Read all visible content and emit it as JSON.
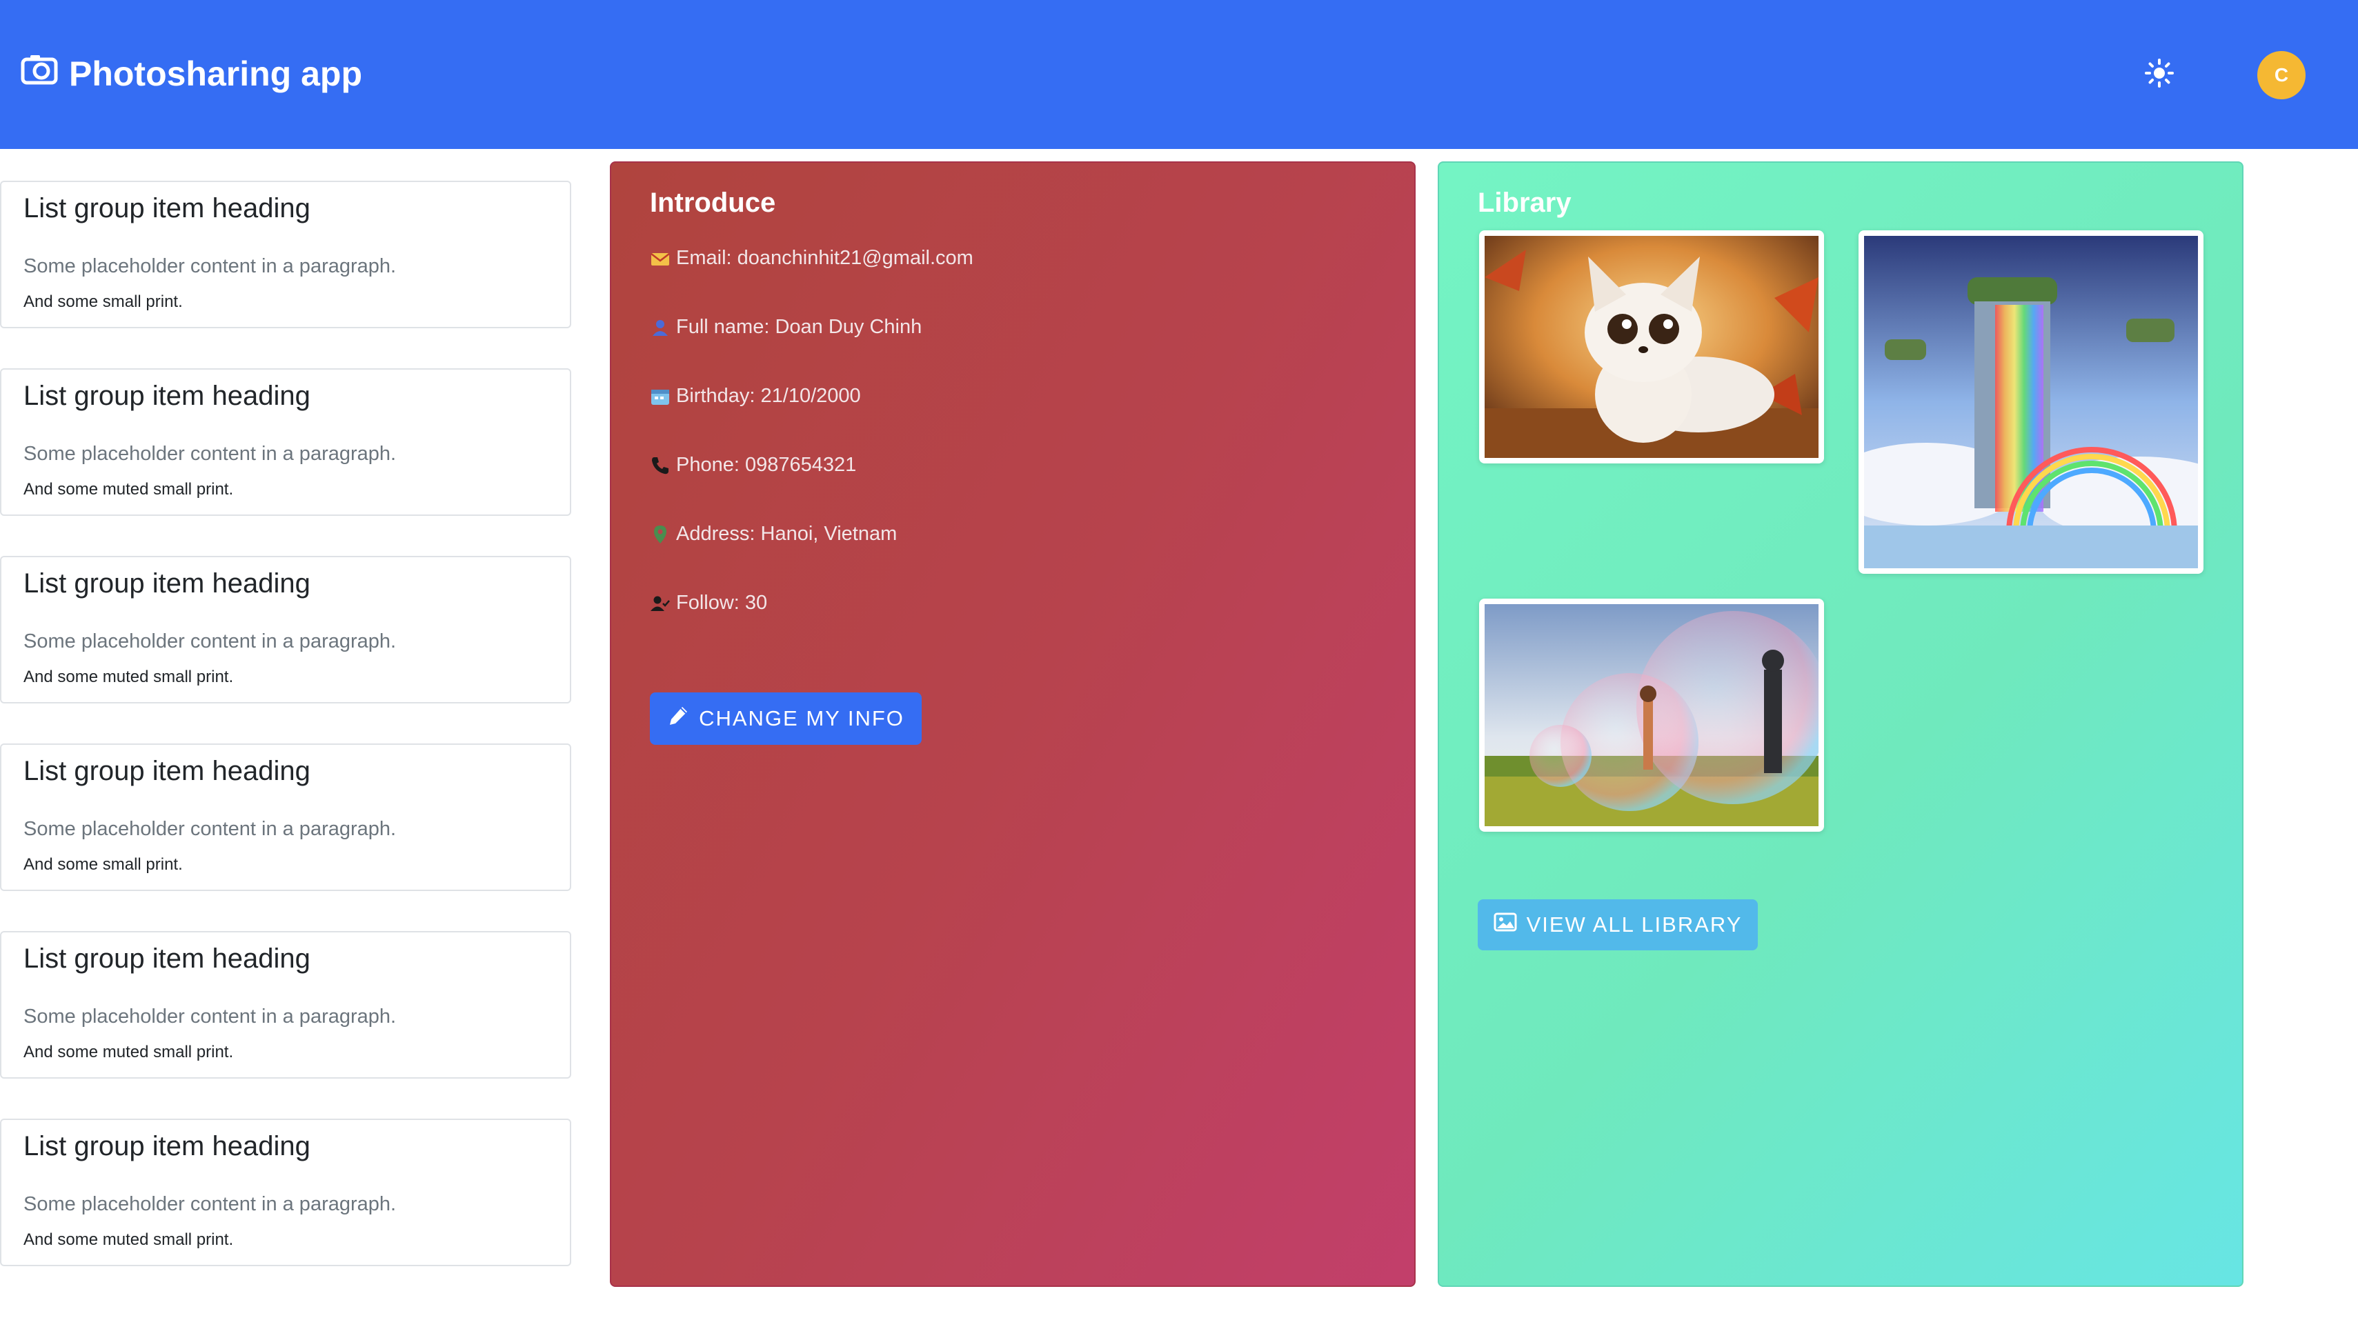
{
  "navbar": {
    "brand_icon": "camera-icon",
    "brand_title": "Photosharing app",
    "theme_icon": "sun-icon",
    "avatar_initial": "C",
    "bg_color": "#356df3",
    "avatar_color": "#f5b833"
  },
  "list": {
    "items": [
      {
        "heading": "List group item heading",
        "text": "Some placeholder content in a paragraph.",
        "small": "And some small print."
      },
      {
        "heading": "List group item heading",
        "text": "Some placeholder content in a paragraph.",
        "small": "And some muted small print."
      },
      {
        "heading": "List group item heading",
        "text": "Some placeholder content in a paragraph.",
        "small": "And some muted small print."
      },
      {
        "heading": "List group item heading",
        "text": "Some placeholder content in a paragraph.",
        "small": "And some small print."
      },
      {
        "heading": "List group item heading",
        "text": "Some placeholder content in a paragraph.",
        "small": "And some muted small print."
      },
      {
        "heading": "List group item heading",
        "text": "Some placeholder content in a paragraph.",
        "small": "And some muted small print."
      }
    ]
  },
  "introduce": {
    "title": "Introduce",
    "rows": [
      {
        "icon": "envelope-icon",
        "text": "Email: doanchinhit21@gmail.com"
      },
      {
        "icon": "user-icon",
        "text": "Full name: Doan Duy Chinh"
      },
      {
        "icon": "calendar-icon",
        "text": "Birthday: 21/10/2000"
      },
      {
        "icon": "phone-icon",
        "text": "Phone: 0987654321"
      },
      {
        "icon": "location-pin-icon",
        "text": "Address: Hanoi, Vietnam"
      },
      {
        "icon": "user-check-icon",
        "text": "Follow: 30"
      }
    ],
    "button_label": "CHANGE MY INFO",
    "button_icon": "pencil-icon"
  },
  "library": {
    "title": "Library",
    "images": [
      {
        "name": "fox-autumn-image"
      },
      {
        "name": "rainbow-waterfall-image"
      },
      {
        "name": "bubbles-meadow-image"
      }
    ],
    "button_label": "VIEW ALL LIBRARY",
    "button_icon": "image-icon"
  }
}
